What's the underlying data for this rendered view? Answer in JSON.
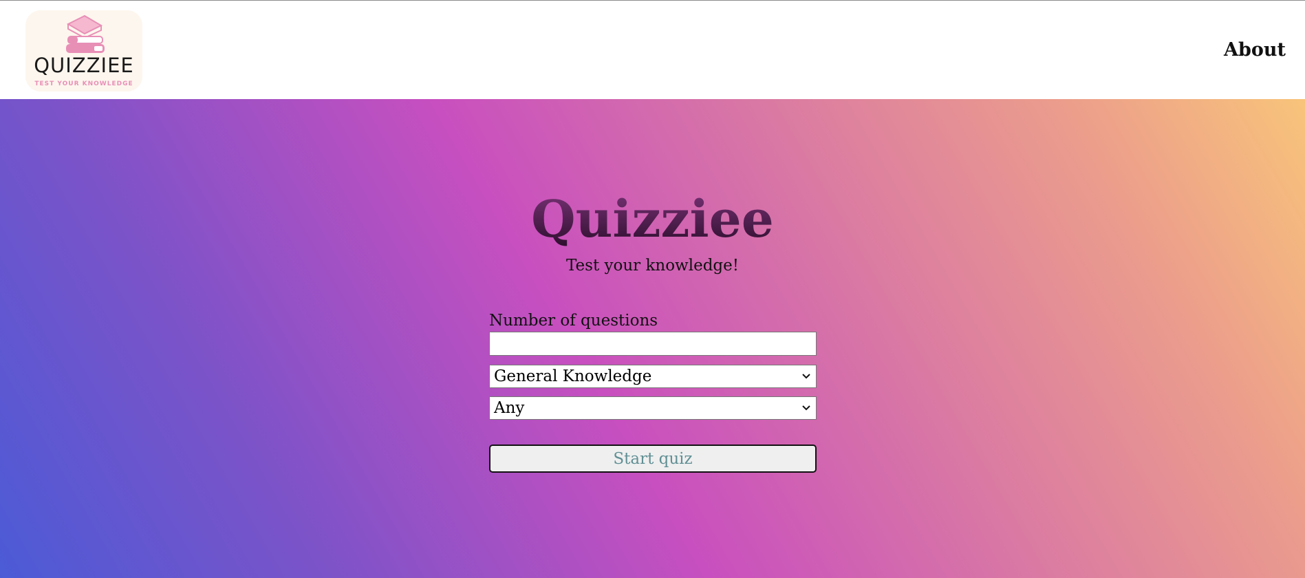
{
  "header": {
    "logo": {
      "wordmark": "QUIZZIEE",
      "tagline": "TEST YOUR KNOWLEDGE",
      "icon": "books-stack-icon"
    },
    "nav": {
      "about_label": "About"
    }
  },
  "main": {
    "title": "Quizziee",
    "subtitle": "Test your knowledge!",
    "form": {
      "questions_label": "Number of questions",
      "questions_value": "",
      "category_selected": "General Knowledge",
      "difficulty_selected": "Any",
      "start_label": "Start quiz"
    }
  },
  "colors": {
    "gradient_start": "#4b5bd6",
    "gradient_mid": "#c84fbf",
    "gradient_end": "#f8c47a",
    "title_color": "#4b1a4a",
    "start_button_text": "#5f8f94",
    "logo_accent": "#e88fb6"
  }
}
